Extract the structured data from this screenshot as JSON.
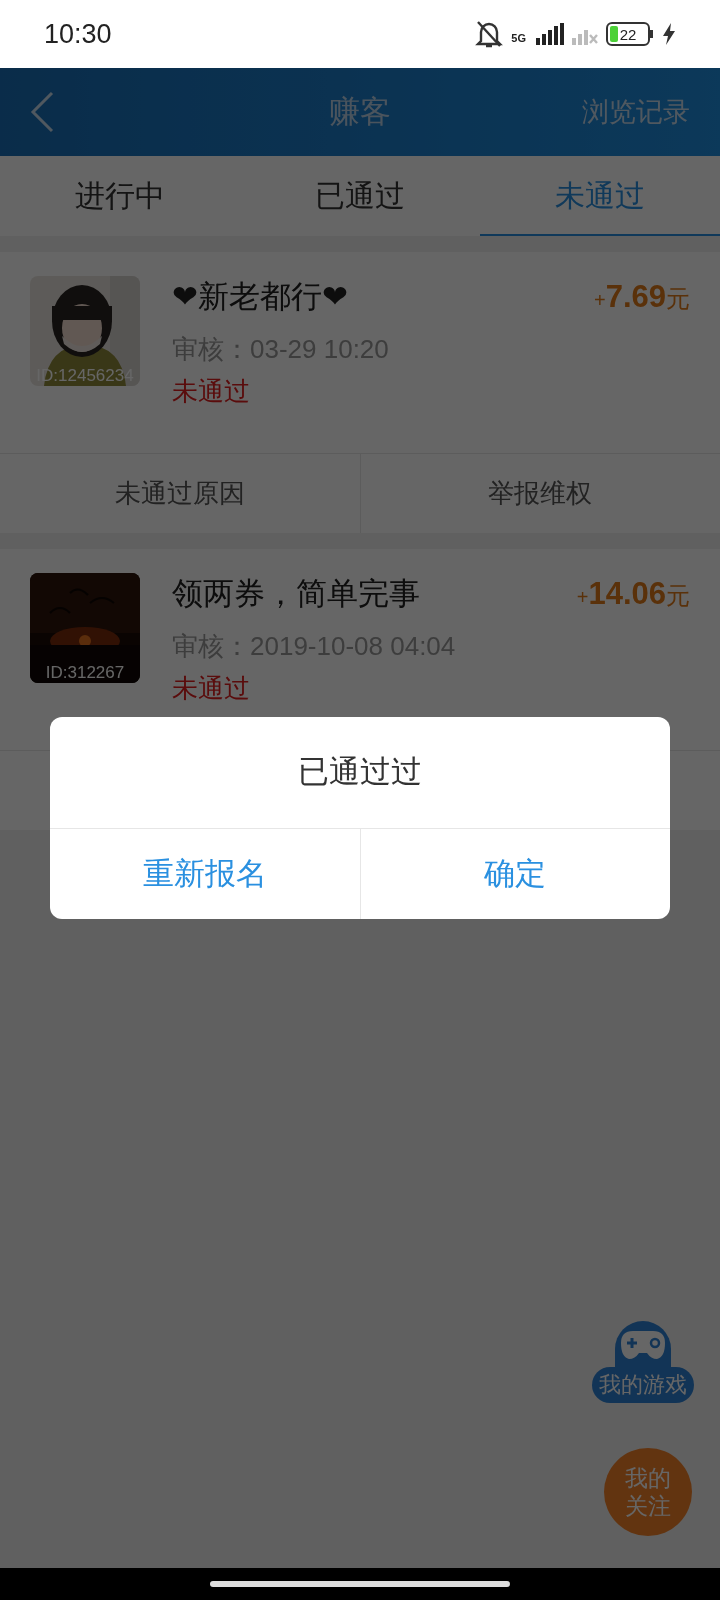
{
  "status_bar": {
    "time": "10:30",
    "network": "5G",
    "battery": "22"
  },
  "header": {
    "title": "赚客",
    "action": "浏览记录"
  },
  "tabs": [
    {
      "label": "进行中",
      "selected": false
    },
    {
      "label": "已通过",
      "selected": false
    },
    {
      "label": "未通过",
      "selected": true
    }
  ],
  "tasks": [
    {
      "title": "❤新老都行❤",
      "reward_sign": "+",
      "reward_amount": "7.69",
      "reward_unit": "元",
      "review": "审核：03-29 10:20",
      "status": "未通过",
      "thumb": {
        "kind": "picture",
        "id": "ID:12456234"
      },
      "actions": [
        "未通过原因",
        "举报维权"
      ]
    },
    {
      "title": "领两券，简单完事",
      "reward_sign": "+",
      "reward_amount": "14.06",
      "reward_unit": "元",
      "review": "审核：2019-10-08 04:04",
      "status": "未通过",
      "thumb": {
        "kind": "picture",
        "id": "ID:312267"
      }
    }
  ],
  "dialog": {
    "message": "已通过过",
    "buttons": [
      "重新报名",
      "确定"
    ]
  },
  "floating": {
    "games": "我的游戏",
    "follow": "我的关注"
  }
}
